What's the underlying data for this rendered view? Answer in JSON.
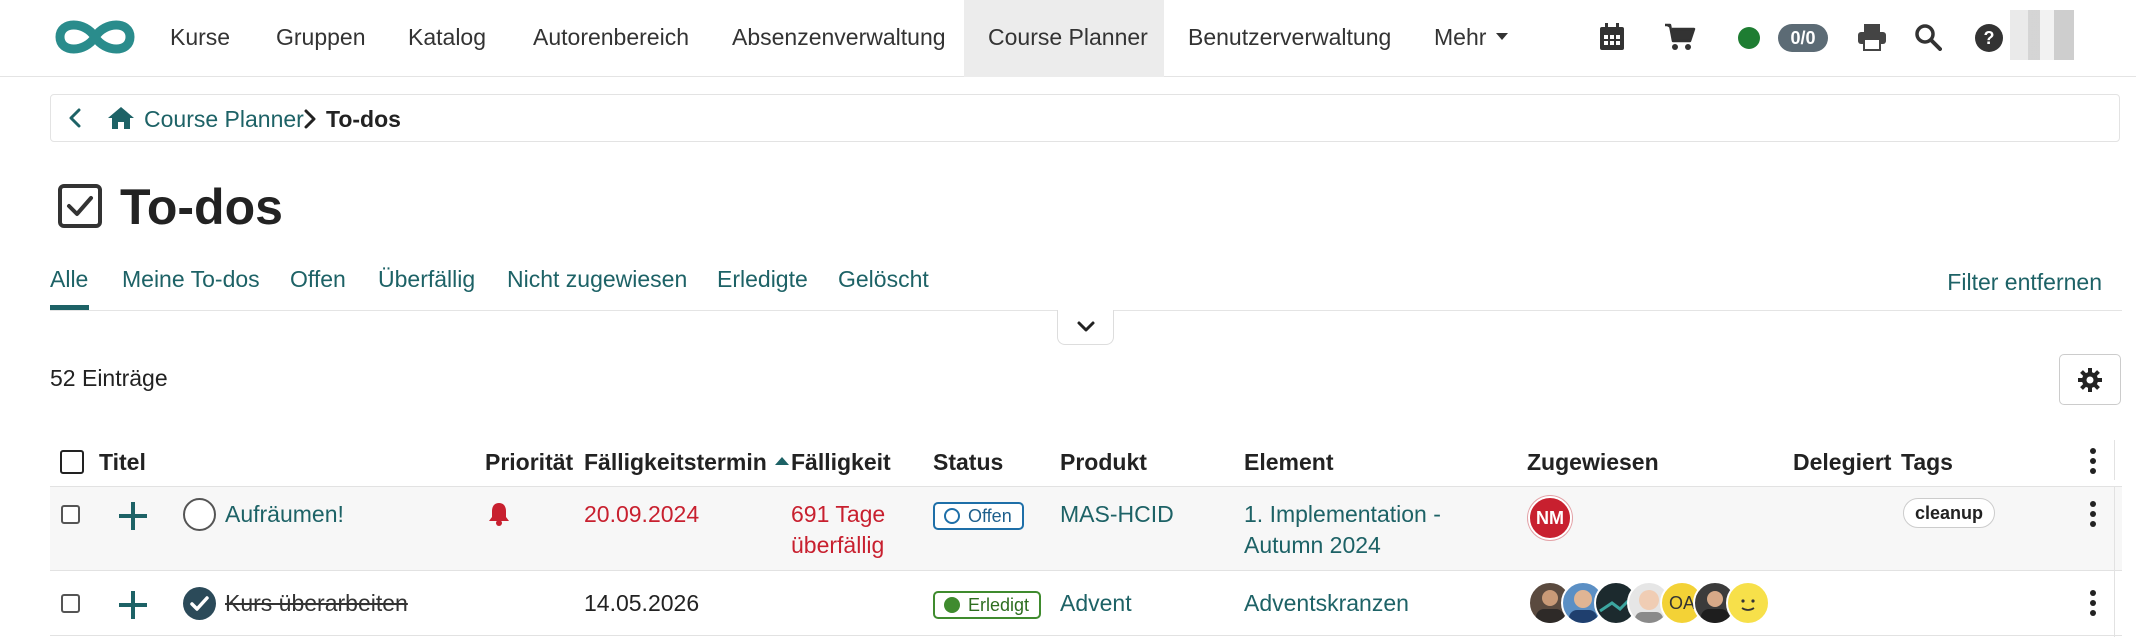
{
  "nav": {
    "items": [
      "Kurse",
      "Gruppen",
      "Katalog",
      "Autorenbereich",
      "Absenzenverwaltung",
      "Course Planner",
      "Benutzerverwaltung",
      "Mehr"
    ],
    "active": "Course Planner",
    "cart_count": "0/0",
    "help": "?",
    "icons": [
      "calendar-icon",
      "cart-icon",
      "status-dot",
      "print-icon",
      "search-icon",
      "help-icon"
    ]
  },
  "breadcrumb": {
    "parent": "Course Planner",
    "current": "To-dos"
  },
  "page": {
    "title": "To-dos"
  },
  "tabs": {
    "items": [
      "Alle",
      "Meine To-dos",
      "Offen",
      "Überfällig",
      "Nicht zugewiesen",
      "Erledigte",
      "Gelöscht"
    ],
    "active": "Alle",
    "filter_remove": "Filter entfernen"
  },
  "list": {
    "entry_count": "52 Einträge"
  },
  "table": {
    "headers": [
      "Titel",
      "Priorität",
      "Fälligkeitstermin",
      "Fälligkeit",
      "Status",
      "Produkt",
      "Element",
      "Zugewiesen",
      "Delegiert",
      "Tags"
    ],
    "sorted_column": "Fälligkeitstermin",
    "rows": [
      {
        "title": "Aufräumen!",
        "done": false,
        "priority": "bell-icon",
        "due_date": "20.09.2024",
        "due_line1": "691 Tage",
        "due_line2": "überfällig",
        "status": "Offen",
        "product": "MAS-HCID",
        "element_line1": "1. Implementation -",
        "element_line2": "Autumn 2024",
        "assignees": [
          "NM"
        ],
        "delegated": "",
        "tags": [
          "cleanup"
        ]
      },
      {
        "title": "Kurs überarbeiten",
        "done": true,
        "priority": "",
        "due_date": "14.05.2026",
        "due_line1": "",
        "due_line2": "",
        "status": "Erledigt",
        "product": "Advent",
        "element_line1": "Adventskranzen",
        "element_line2": "",
        "assignees": [
          "",
          "",
          "",
          "",
          "OA",
          "",
          ""
        ],
        "delegated": "",
        "tags": []
      }
    ]
  },
  "colors": {
    "accent": "#1d6266",
    "overdue": "#c8202f",
    "open_badge": "#1e6fa8",
    "done_badge": "#3f8b2e",
    "online": "#1e7d32"
  }
}
